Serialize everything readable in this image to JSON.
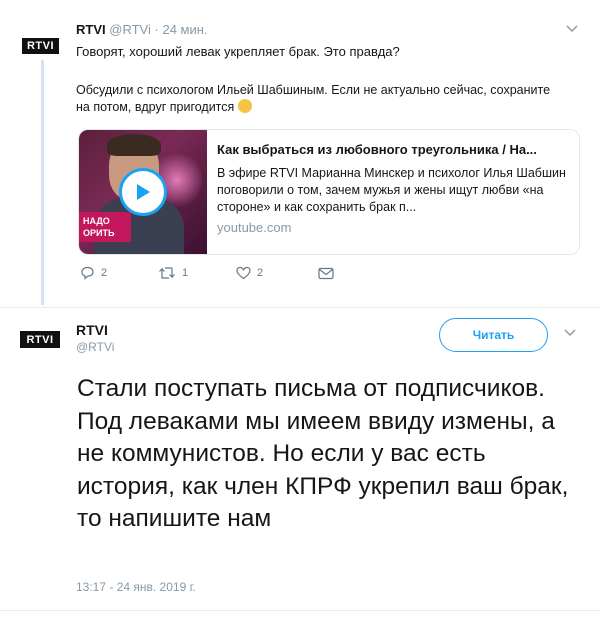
{
  "tweet1": {
    "logo_text": "RTVI",
    "name": "RTVI",
    "handle": "@RTVi",
    "separator": "·",
    "time": "24 мин.",
    "line1": "Говорят, хороший левак укрепляет брак. Это правда?",
    "paragraph": "Обсудили с психологом Ильей Шабшиным. Если не актуально сейчас, сохраните на потом, вдруг пригодится",
    "emoji_icon": "winking-face-icon",
    "card": {
      "title": "Как выбраться из любовного треугольника / На...",
      "description": "В эфире RTVI Марианна Минскер и психолог Илья Шабшин поговорили о том, зачем мужья и жены ищут любви «на стороне» и как сохранить брак п...",
      "domain": "youtube.com",
      "thumb_banner": "НАДО ОРИТЬ"
    },
    "actions": {
      "replies": "2",
      "retweets": "1",
      "likes": "2"
    }
  },
  "tweet2": {
    "logo_text": "RTVI",
    "name": "RTVI",
    "handle": "@RTVi",
    "follow_label": "Читать",
    "text": "Стали поступать письма от подписчиков. Под леваками мы имеем ввиду измены, а не коммунистов. Но если у вас есть история, как член КПРФ укрепил ваш брак, то напишите нам",
    "timestamp": "13:17 - 24 янв. 2019 г."
  },
  "colors": {
    "accent": "#1da1f2",
    "muted": "#8899a6",
    "thread_line": "#d4e2f2"
  }
}
